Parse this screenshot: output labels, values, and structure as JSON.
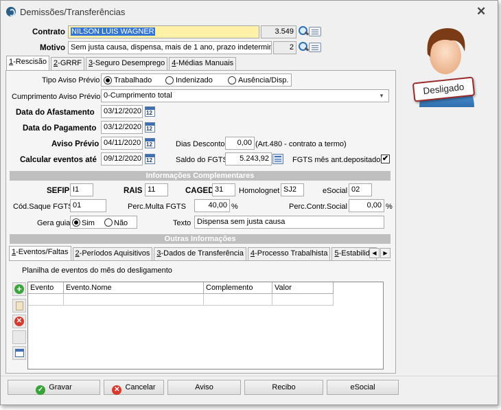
{
  "window": {
    "title": "Demissões/Transferências"
  },
  "header": {
    "contrato_label": "Contrato",
    "contrato_value": "NILSON LUIS WAGNER",
    "contrato_code": "3.549",
    "motivo_label": "Motivo",
    "motivo_value": "Sem justa causa, dispensa, mais de 1 ano, prazo indetermina",
    "motivo_code": "2"
  },
  "status_badge": "Desligado",
  "tabs": [
    {
      "key": "1",
      "label": "-Rescisão"
    },
    {
      "key": "2",
      "label": "-GRRF"
    },
    {
      "key": "3",
      "label": "-Seguro Desemprego"
    },
    {
      "key": "4",
      "label": "-Médias Manuais"
    }
  ],
  "rescisao": {
    "tipo_aviso_label": "Tipo Aviso Prévio",
    "tipo_aviso_options": [
      "Trabalhado",
      "Indenizado",
      "Ausência/Disp."
    ],
    "tipo_aviso_selected": 0,
    "cumprimento_label": "Cumprimento Aviso Prévio",
    "cumprimento_value": "0-Cumprimento total",
    "data_afastamento_label": "Data do Afastamento",
    "data_afastamento": "03/12/2020",
    "data_pagamento_label": "Data do Pagamento",
    "data_pagamento": "03/12/2020",
    "aviso_previo_label": "Aviso Prévio",
    "aviso_previo": "04/11/2020",
    "dias_desconto_label": "Dias Desconto",
    "dias_desconto": "0,00",
    "dias_desconto_note": "(Art.480 - contrato a termo)",
    "calcular_label": "Calcular eventos até",
    "calcular": "09/12/2020",
    "saldo_fgts_label": "Saldo do FGTS",
    "saldo_fgts": "5.243,92",
    "fgts_mes_label": "FGTS mês ant.depositado",
    "fgts_mes_checked": "✔"
  },
  "complementares": {
    "title": "Informações Complementares",
    "sefip_label": "SEFIP",
    "sefip": "I1",
    "rais_label": "RAIS",
    "rais": "11",
    "caged_label": "CAGED",
    "caged": "31",
    "homolognet_label": "Homolognet",
    "homolognet": "SJ2",
    "esocial_label": "eSocial",
    "esocial": "02",
    "cod_saque_label": "Cód.Saque FGTS",
    "cod_saque": "01",
    "perc_multa_label": "Perc.Multa FGTS",
    "perc_multa": "40,00",
    "perc_multa_unit": "%",
    "perc_contr_label": "Perc.Contr.Social",
    "perc_contr": "0,00",
    "perc_contr_unit": "%",
    "gera_guia_label": "Gera guia",
    "gera_guia_options": [
      "Sim",
      "Não"
    ],
    "gera_guia_selected": 0,
    "texto_label": "Texto",
    "texto": "Dispensa sem justa causa"
  },
  "outras": {
    "title": "Outras Informações",
    "tabs": [
      {
        "key": "1",
        "label": "-Eventos/Faltas"
      },
      {
        "key": "2",
        "label": "-Períodos Aquisitivos"
      },
      {
        "key": "3",
        "label": "-Dados de Transferência"
      },
      {
        "key": "4",
        "label": "-Processo Trabalhista"
      },
      {
        "key": "5",
        "label": "-Estabilid"
      }
    ],
    "planilha_label": "Planilha de eventos do mês do desligamento",
    "columns": [
      "Evento",
      "Evento.Nome",
      "Complemento",
      "Valor"
    ]
  },
  "buttons": {
    "gravar": "Gravar",
    "cancelar": "Cancelar",
    "aviso": "Aviso",
    "recibo": "Recibo",
    "esocial": "eSocial"
  }
}
